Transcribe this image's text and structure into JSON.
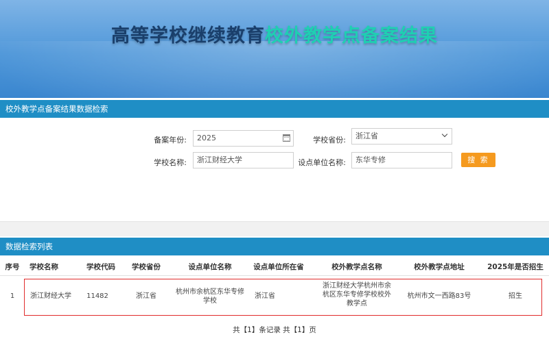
{
  "banner": {
    "title_part1": "高等学校继续教育",
    "title_part2": "校外教学点备案结果"
  },
  "search_section": {
    "title": "校外教学点备案结果数据检索",
    "year_label": "备案年份:",
    "year_value": "2025",
    "province_label": "学校省份:",
    "province_value": "浙江省",
    "school_label": "学校名称:",
    "school_value": "浙江财经大学",
    "unit_label": "设点单位名称:",
    "unit_value": "东华专修",
    "search_button": "搜 索"
  },
  "results_section": {
    "title": "数据检索列表",
    "columns": [
      "序号",
      "学校名称",
      "学校代码",
      "学校省份",
      "设点单位名称",
      "设点单位所在省",
      "校外教学点名称",
      "校外教学点地址",
      "2025年是否招生"
    ],
    "rows": [
      {
        "index": "1",
        "school": "浙江财经大学",
        "code": "11482",
        "province": "浙江省",
        "unit_line1": "杭州市余杭区东华专修",
        "unit_line2": "学校",
        "unit_province": "浙江省",
        "site_line1": "浙江财经大学杭州市余",
        "site_line2": "杭区东华专修学校校外",
        "site_line3": "教学点",
        "address": "杭州市文一西路83号",
        "enroll": "招生"
      }
    ]
  },
  "pager": {
    "text": "共【1】条记录 共【1】页"
  },
  "colors": {
    "banner": "#4f97d9",
    "bar": "#1f8ec5",
    "accent": "#1fcfb2",
    "button": "#f59a1f",
    "highlight": "#e02a2a"
  }
}
